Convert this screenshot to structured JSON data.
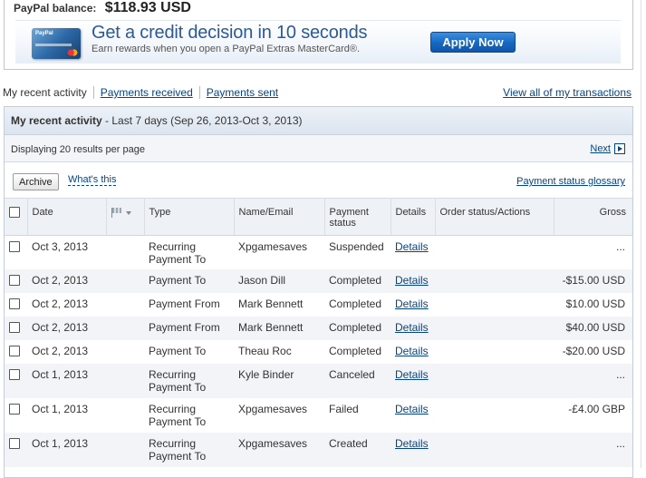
{
  "balance": {
    "label": "PayPal balance:",
    "value": "$118.93 USD"
  },
  "promo": {
    "headline": "Get a credit decision in 10 seconds",
    "subtext": "Earn rewards when you open a PayPal Extras MasterCard®.",
    "cta": "Apply Now",
    "card_logo": "PayPal",
    "brand_color": "#2c5a95",
    "button_color": "#1667c1"
  },
  "tabs": [
    {
      "label": "My recent activity",
      "active": true
    },
    {
      "label": "Payments received",
      "active": false
    },
    {
      "label": "Payments sent",
      "active": false
    }
  ],
  "view_all": "View all of my transactions",
  "panel": {
    "title": "My recent activity",
    "range": " - Last 7 days (Sep 26, 2013-Oct 3, 2013)"
  },
  "results": {
    "text": "Displaying 20 results per page",
    "next": "Next"
  },
  "tools": {
    "archive": "Archive",
    "whats_this": "What's this",
    "glossary": "Payment status glossary"
  },
  "columns": {
    "date": "Date",
    "type": "Type",
    "name": "Name/Email",
    "status": "Payment status",
    "details": "Details",
    "order": "Order status/Actions",
    "gross": "Gross"
  },
  "icons": {
    "flag": "flag-icon",
    "flag_menu": "chevron-down-icon",
    "next": "next-arrow-icon"
  },
  "rows": [
    {
      "date": "Oct 3, 2013",
      "type": "Recurring Payment To",
      "name": "Xpgamesaves",
      "status": "Suspended",
      "details": "Details",
      "gross": "..."
    },
    {
      "date": "Oct 2, 2013",
      "type": "Payment To",
      "name": "Jason Dill",
      "status": "Completed",
      "details": "Details",
      "gross": "-$15.00 USD"
    },
    {
      "date": "Oct 2, 2013",
      "type": "Payment From",
      "name": "Mark Bennett",
      "status": "Completed",
      "details": "Details",
      "gross": "$10.00 USD"
    },
    {
      "date": "Oct 2, 2013",
      "type": "Payment From",
      "name": "Mark Bennett",
      "status": "Completed",
      "details": "Details",
      "gross": "$40.00 USD"
    },
    {
      "date": "Oct 2, 2013",
      "type": "Payment To",
      "name": "Theau Roc",
      "status": "Completed",
      "details": "Details",
      "gross": "-$20.00 USD"
    },
    {
      "date": "Oct 1, 2013",
      "type": "Recurring Payment To",
      "name": "Kyle Binder",
      "status": "Canceled",
      "details": "Details",
      "gross": "..."
    },
    {
      "date": "Oct 1, 2013",
      "type": "Recurring Payment To",
      "name": "Xpgamesaves",
      "status": "Failed",
      "details": "Details",
      "gross": "-£4.00 GBP"
    },
    {
      "date": "Oct 1, 2013",
      "type": "Recurring Payment To",
      "name": "Xpgamesaves",
      "status": "Created",
      "details": "Details",
      "gross": "..."
    }
  ]
}
